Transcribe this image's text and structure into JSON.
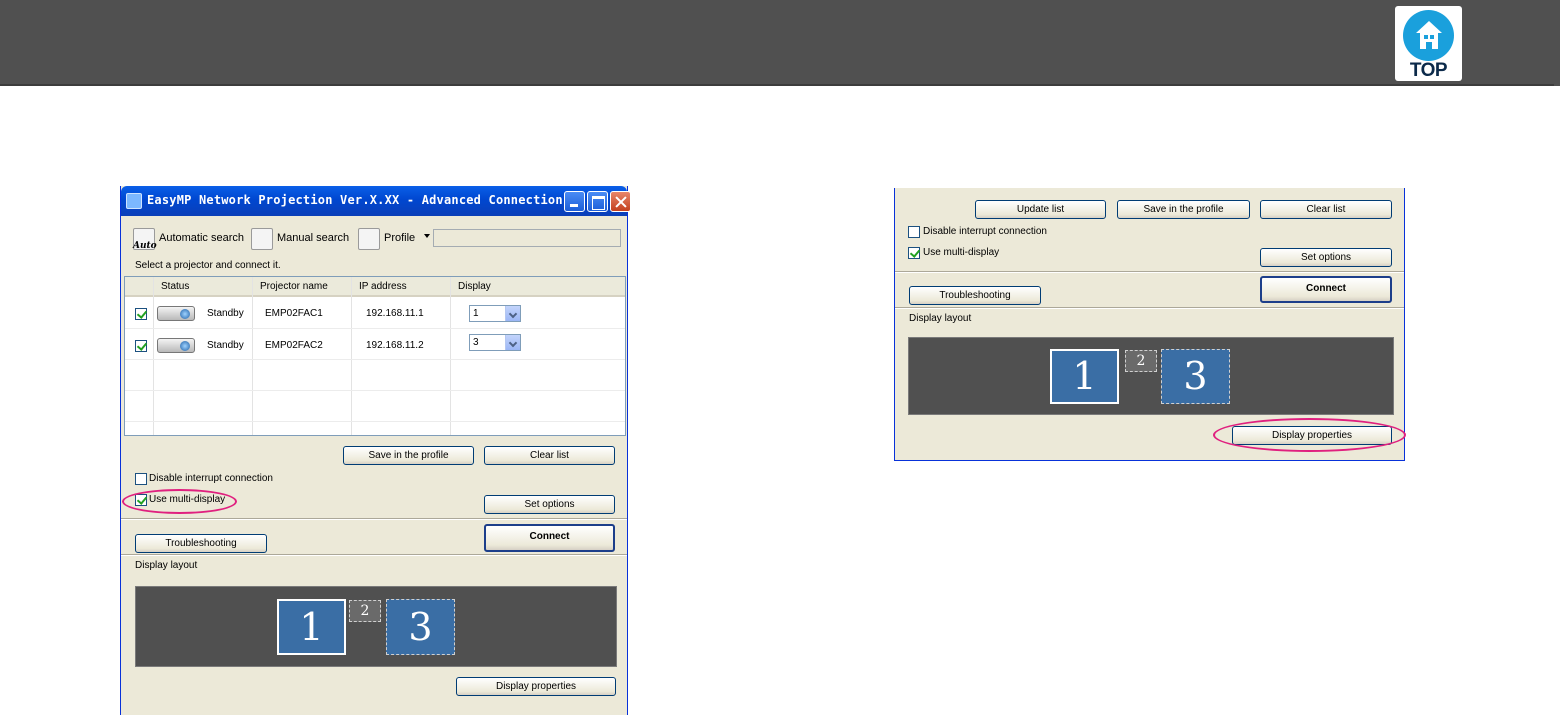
{
  "header": {
    "top_icon": {
      "label": "TOP",
      "color": "#1aa0dc"
    }
  },
  "window1": {
    "title": "EasyMP Network Projection Ver.X.XX - Advanced Connection -",
    "toolbar": {
      "auto_sub": "Auto",
      "automatic_search": "Automatic search",
      "manual_search": "Manual search",
      "profile": "Profile"
    },
    "select_label": "Select a projector and connect it.",
    "columns": [
      "Status",
      "Projector name",
      "IP address",
      "Display"
    ],
    "rows": [
      {
        "checked": true,
        "status": "Standby",
        "name": "EMP02FAC1",
        "ip": "192.168.11.1",
        "display": "1"
      },
      {
        "checked": true,
        "status": "Standby",
        "name": "EMP02FAC2",
        "ip": "192.168.11.2",
        "display": "3"
      }
    ],
    "save_profile": "Save in the profile",
    "clear_list": "Clear list",
    "disable_interrupt": "Disable interrupt connection",
    "use_multi_display": "Use multi-display",
    "set_options": "Set options",
    "troubleshooting": "Troubleshooting",
    "connect": "Connect",
    "display_layout": "Display layout",
    "displays": [
      "1",
      "2",
      "3"
    ],
    "display_properties": "Display properties"
  },
  "window2": {
    "update_list": "Update list",
    "save_profile": "Save in the profile",
    "clear_list": "Clear list",
    "disable_interrupt": "Disable interrupt connection",
    "use_multi_display": "Use multi-display",
    "set_options": "Set options",
    "troubleshooting": "Troubleshooting",
    "connect": "Connect",
    "display_layout": "Display layout",
    "displays": [
      "1",
      "2",
      "3"
    ],
    "display_properties": "Display properties"
  },
  "colors": {
    "highlight": "#e0207f",
    "titlebar": "#0a5fe8",
    "layout_bg": "#505050",
    "display_fill": "#3a6ea5"
  }
}
